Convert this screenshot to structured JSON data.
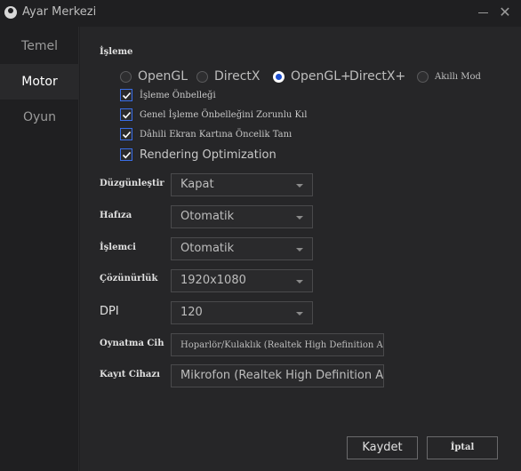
{
  "window": {
    "title": "Ayar Merkezi"
  },
  "sidebar": {
    "items": [
      {
        "label": "Temel"
      },
      {
        "label": "Motor"
      },
      {
        "label": "Oyun"
      }
    ]
  },
  "render": {
    "section_label": "İşleme",
    "options": [
      {
        "label": "OpenGL",
        "checked": false
      },
      {
        "label": "DirectX",
        "checked": false
      },
      {
        "label": "OpenGL+",
        "checked": true
      },
      {
        "label": "DirectX+",
        "checked": false
      },
      {
        "label": "Akıllı Mod",
        "checked": false
      }
    ],
    "checkboxes": [
      {
        "label": "İşleme Önbelleği",
        "checked": true
      },
      {
        "label": "Genel İşleme Önbelleğini Zorunlu Kıl",
        "checked": true
      },
      {
        "label": "Dâhili Ekran Kartına Öncelik Tanı",
        "checked": true
      },
      {
        "label": "Rendering Optimization",
        "checked": true
      }
    ]
  },
  "settings": {
    "antialias": {
      "label": "Düzgünleştir",
      "value": "Kapat"
    },
    "memory": {
      "label": "Hafıza",
      "value": "Otomatik"
    },
    "cpu": {
      "label": "İşlemci",
      "value": "Otomatik"
    },
    "resolution": {
      "label": "Çözünürlük",
      "value": "1920x1080"
    },
    "dpi": {
      "label": "DPI",
      "value": "120"
    },
    "playback": {
      "label": "Oynatma Cih",
      "value": "Hoparlör/Kulaklık (Realtek High Definition Audio)"
    },
    "recording": {
      "label": "Kayıt Cihazı",
      "value": "Mikrofon (Realtek High Definition Audio)"
    }
  },
  "buttons": {
    "save": "Kaydet",
    "cancel": "İptal"
  },
  "colors": {
    "accent": "#1d4fd0",
    "background": "#262628",
    "sidebar": "#1f1f21"
  },
  "icons": {
    "logo": "app-logo-icon",
    "minimize": "minimize-icon",
    "close": "close-icon",
    "check": "check-icon",
    "caret": "chevron-down-icon"
  }
}
